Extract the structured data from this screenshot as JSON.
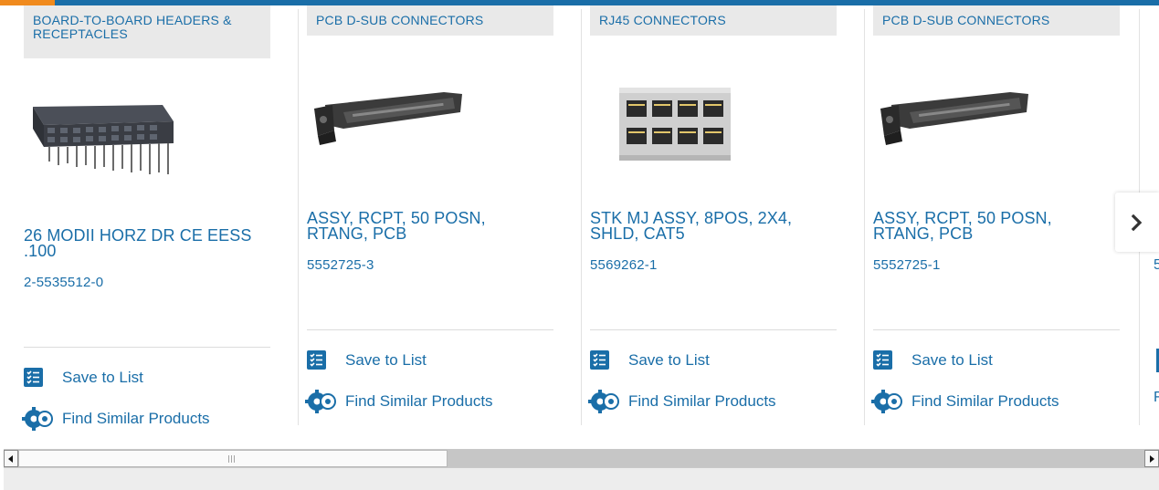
{
  "cards": [
    {
      "category": "BOARD-TO-BOARD HEADERS & RECEPTACLES",
      "image": "board-to-board-header-image",
      "title": "26 MODII HORZ DR CE EESS .100",
      "part_number": "2-5535512-0",
      "save_label": "Save to List",
      "find_label": "Find Similar Products"
    },
    {
      "category": "PCB D-SUB CONNECTORS",
      "image": "d-sub-connector-image",
      "title": "ASSY, RCPT, 50 POSN, RTANG, PCB",
      "part_number": "5552725-3",
      "save_label": "Save to List",
      "find_label": "Find Similar Products"
    },
    {
      "category": "RJ45 CONNECTORS",
      "image": "rj45-connector-image",
      "title": "STK MJ ASSY, 8POS, 2X4, SHLD, CAT5",
      "part_number": "5569262-1",
      "save_label": "Save to List",
      "find_label": "Find Similar Products"
    },
    {
      "category": "PCB D-SUB CONNECTORS",
      "image": "d-sub-connector-image",
      "title": "ASSY, RCPT, 50 POSN, RTANG, PCB",
      "part_number": "5552725-1",
      "save_label": "Save to List",
      "find_label": "Find Similar Products"
    }
  ],
  "peek": {
    "part_number_fragment": "5",
    "find_fragment": "F"
  },
  "icons": {
    "save": "save-to-list-icon",
    "find": "find-similar-gears-icon",
    "next": "chevron-right-icon"
  },
  "colors": {
    "link": "#1a6ea8",
    "accent": "#f08a1d",
    "category_bg": "#e9e9e9"
  }
}
